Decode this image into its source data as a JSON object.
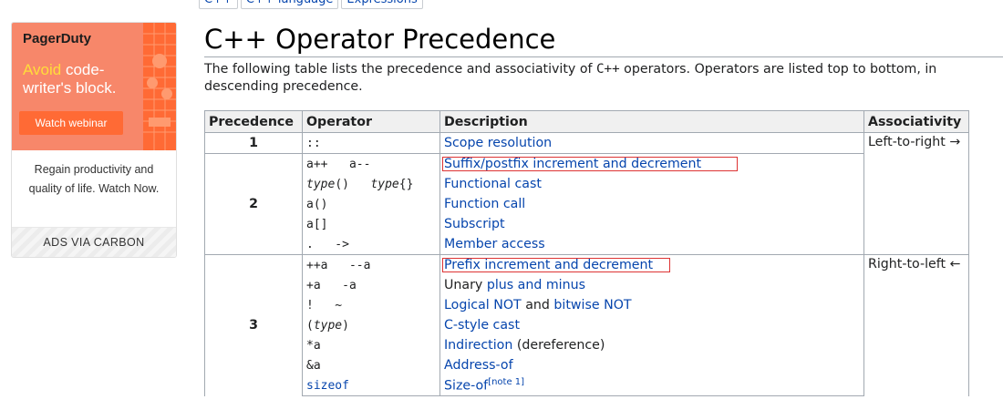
{
  "breadcrumb": {
    "items": [
      "C++",
      "C++ language",
      "Expressions"
    ]
  },
  "ad": {
    "brand": "PagerDuty",
    "headline_accent": "Avoid",
    "headline_rest": " code-writer's block.",
    "cta": "Watch webinar",
    "text": "Regain productivity and quality of life. Watch Now.",
    "footer": "ADS VIA CARBON",
    "colors": {
      "banner": "#f7876a",
      "cta": "#ff6a35",
      "accent": "#ffdd3a"
    }
  },
  "page": {
    "title": "C++ Operator Precedence",
    "intro_pre": "The following table lists the precedence and associativity of ",
    "intro_code": "C++",
    "intro_post": " operators. Operators are listed top to bottom, in descending precedence."
  },
  "table": {
    "headers": [
      "Precedence",
      "Operator",
      "Description",
      "Associativity"
    ],
    "groups": [
      {
        "precedence": "1",
        "associativity": "Left-to-right →",
        "rows": [
          {
            "operator": "::",
            "description": "Scope resolution"
          }
        ]
      },
      {
        "precedence": "2",
        "rows": [
          {
            "operator": "a++   a--",
            "description": "Suffix/postfix increment and decrement"
          },
          {
            "operator_italic_1": "type",
            "operator_mid": "()   ",
            "operator_italic_2": "type",
            "operator_tail": "{}",
            "description": "Functional cast"
          },
          {
            "operator": "a()",
            "description": "Function call"
          },
          {
            "operator": "a[]",
            "description": "Subscript"
          },
          {
            "operator": ".   ->",
            "description": "Member access"
          }
        ]
      },
      {
        "precedence": "3",
        "associativity": "Right-to-left ←",
        "rows": [
          {
            "operator": "++a   --a",
            "description": "Prefix increment and decrement"
          },
          {
            "operator": "+a   -a",
            "description_pre": "Unary ",
            "description_link": "plus and minus"
          },
          {
            "operator": "!   ~",
            "description_link1": "Logical NOT",
            "description_mid": " and ",
            "description_link2": "bitwise NOT"
          },
          {
            "operator_pre": "(",
            "operator_italic": "type",
            "operator_post": ")",
            "description": "C-style cast"
          },
          {
            "operator": "*a",
            "description_link": "Indirection",
            "description_post": " (dereference)"
          },
          {
            "operator": "&a",
            "description": "Address-of"
          },
          {
            "operator": "sizeof",
            "description": "Size-of",
            "note": "[note 1]"
          }
        ]
      }
    ]
  }
}
